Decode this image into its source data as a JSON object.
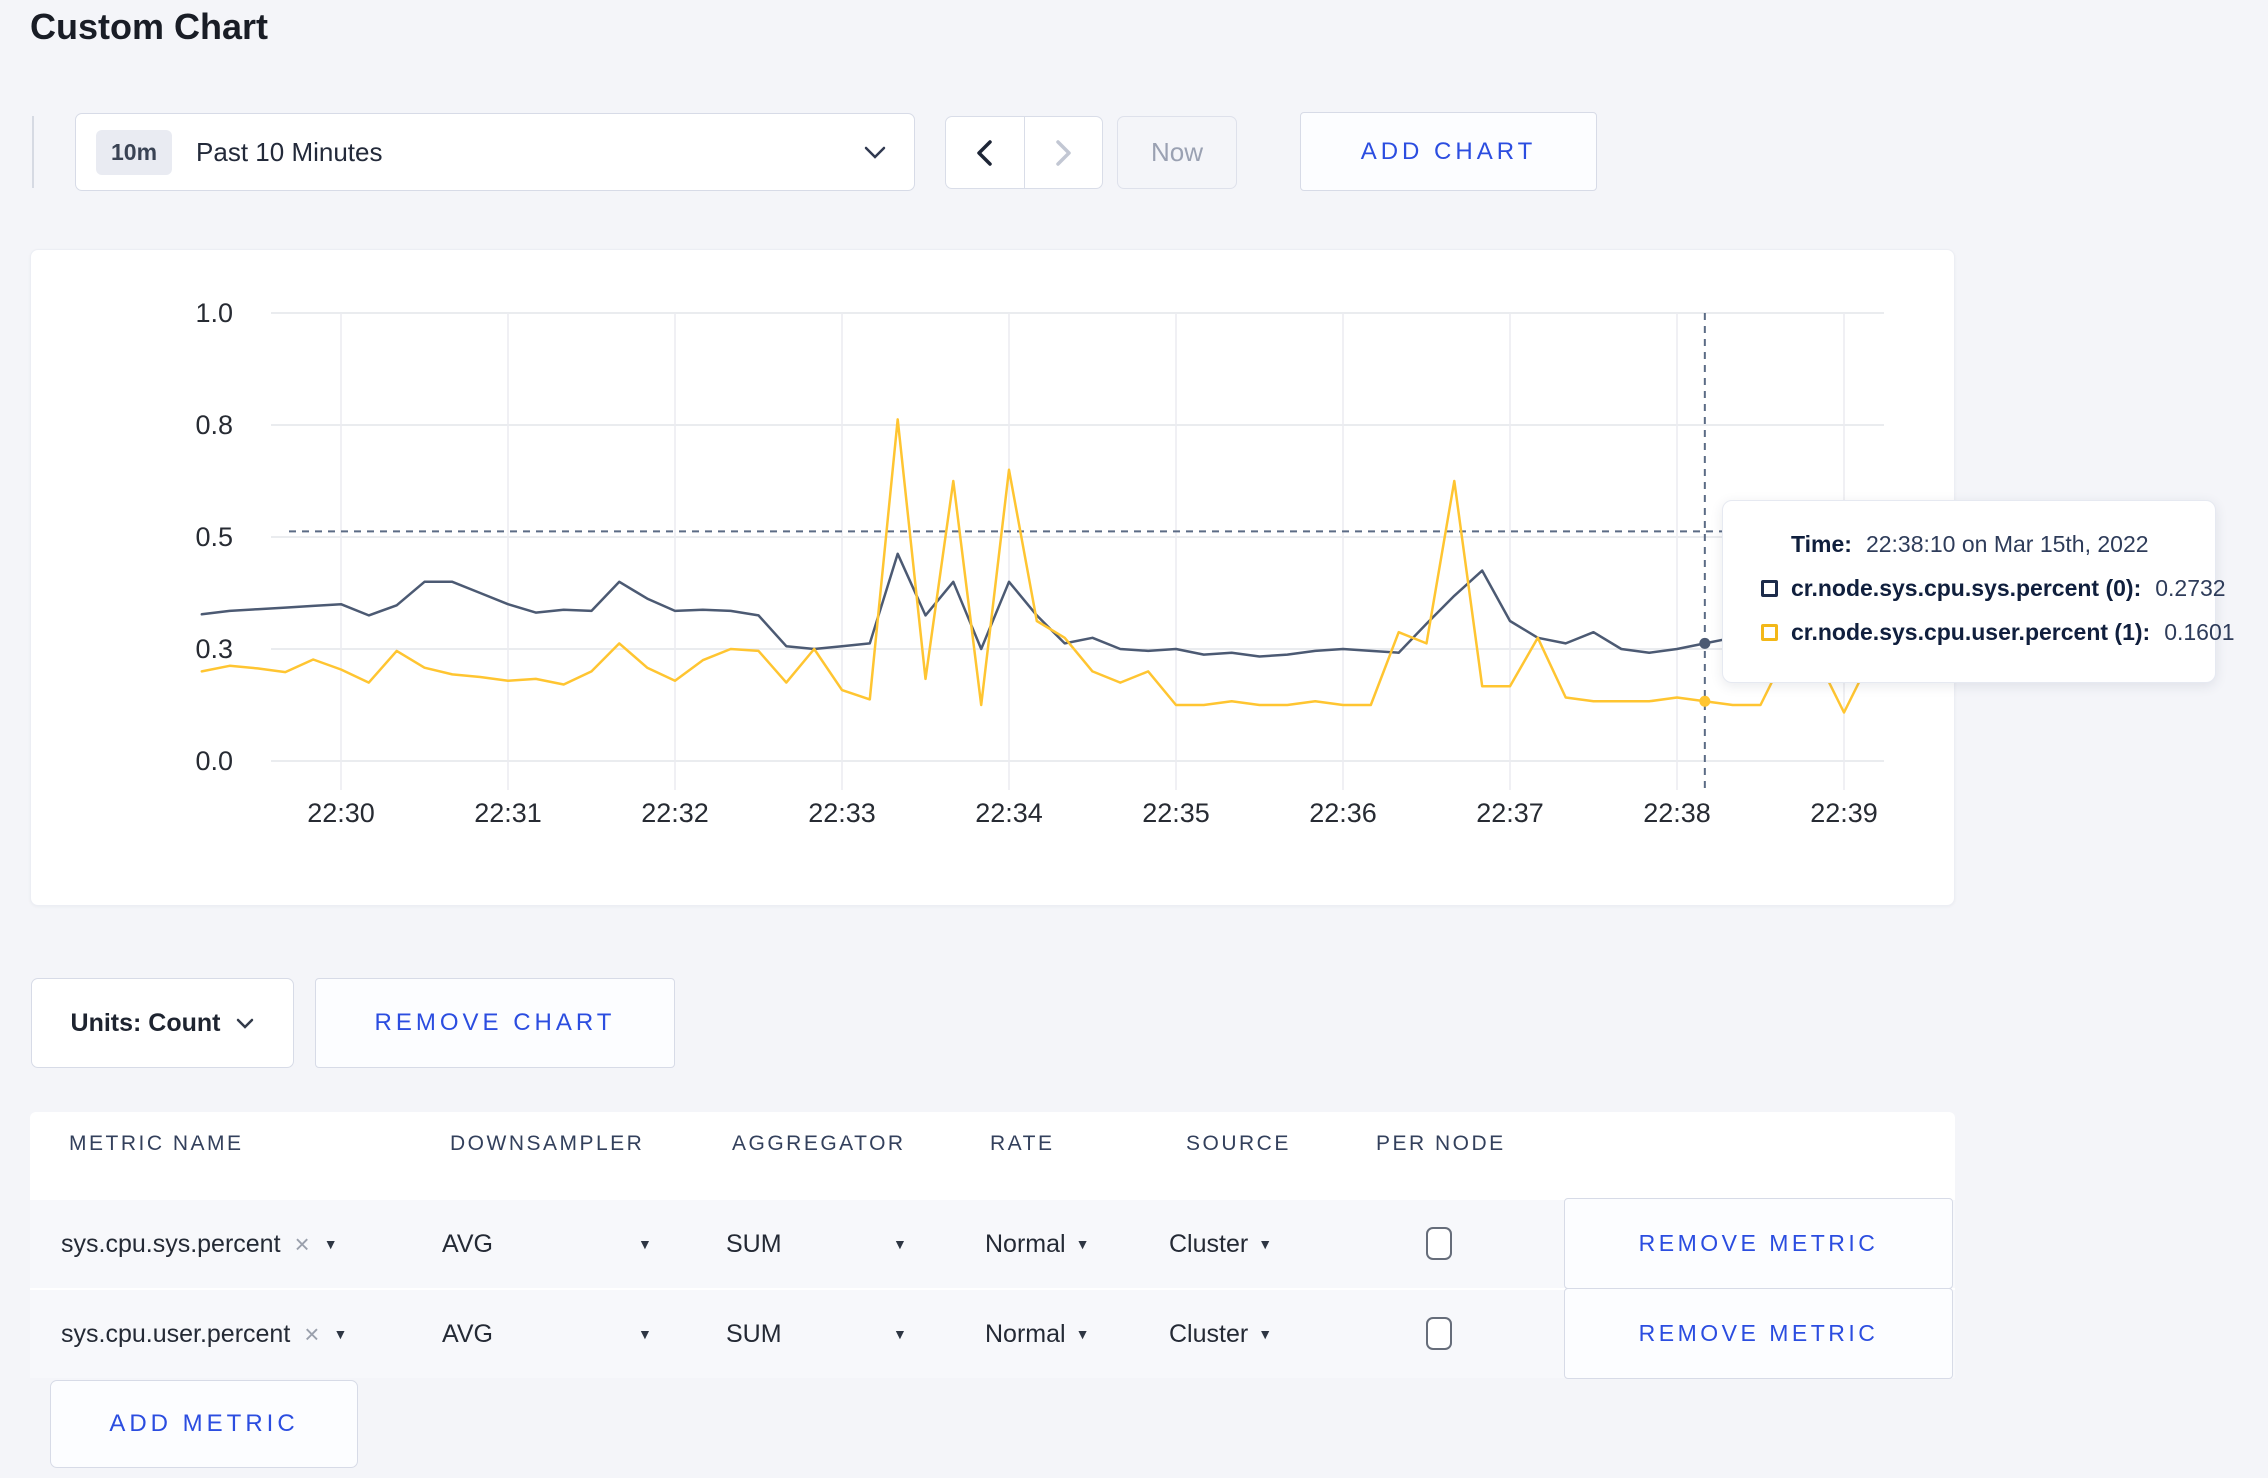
{
  "page": {
    "title": "Custom Chart"
  },
  "toolbar": {
    "time_window": {
      "badge": "10m",
      "label": "Past 10 Minutes"
    },
    "prev_icon": "chevron-left",
    "next_icon": "chevron-right",
    "now_label": "Now",
    "add_chart_label": "ADD CHART"
  },
  "chart_data": {
    "type": "line",
    "title": "",
    "xlabel": "",
    "ylabel": "",
    "grid": true,
    "legend_position": "none",
    "y_tick_labels": [
      "1.0",
      "0.8",
      "0.5",
      "0.3",
      "0.0"
    ],
    "y_tick_values": [
      1.0,
      0.8,
      0.5,
      0.3,
      0.0
    ],
    "x_tick_labels": [
      "22:30",
      "22:31",
      "22:32",
      "22:33",
      "22:34",
      "22:35",
      "22:36",
      "22:37",
      "22:38",
      "22:39"
    ],
    "x_start_offset_sec": -50,
    "interval_sec": 10,
    "series": [
      {
        "name": "cr.node.sys.cpu.sys.percent (0)",
        "color": "#4c5a73",
        "values": [
          0.362,
          0.368,
          0.371,
          0.374,
          0.377,
          0.38,
          0.36,
          0.378,
          0.42,
          0.42,
          0.4,
          0.38,
          0.365,
          0.37,
          0.368,
          0.42,
          0.39,
          0.368,
          0.37,
          0.368,
          0.36,
          0.305,
          0.3,
          0.305,
          0.31,
          0.47,
          0.36,
          0.42,
          0.3,
          0.42,
          0.36,
          0.31,
          0.32,
          0.3,
          0.295,
          0.3,
          0.285,
          0.29,
          0.28,
          0.285,
          0.295,
          0.3,
          0.295,
          0.29,
          0.345,
          0.395,
          0.44,
          0.35,
          0.32,
          0.31,
          0.33,
          0.3,
          0.29,
          0.3,
          0.31,
          0.32,
          0.31,
          0.3,
          0.305,
          0.3,
          0.302
        ]
      },
      {
        "name": "cr.node.sys.cpu.user.percent (1)",
        "color": "#ffc531",
        "values": [
          0.24,
          0.255,
          0.248,
          0.238,
          0.272,
          0.245,
          0.21,
          0.295,
          0.25,
          0.232,
          0.225,
          0.215,
          0.22,
          0.205,
          0.24,
          0.31,
          0.25,
          0.215,
          0.27,
          0.3,
          0.295,
          0.21,
          0.3,
          0.19,
          0.165,
          0.81,
          0.22,
          0.65,
          0.15,
          0.68,
          0.35,
          0.32,
          0.24,
          0.21,
          0.24,
          0.15,
          0.15,
          0.16,
          0.15,
          0.15,
          0.16,
          0.15,
          0.15,
          0.33,
          0.31,
          0.65,
          0.2,
          0.2,
          0.32,
          0.17,
          0.16,
          0.16,
          0.16,
          0.17,
          0.16,
          0.15,
          0.15,
          0.3,
          0.28,
          0.13,
          0.28
        ]
      }
    ],
    "crosshair": {
      "index": 54,
      "hline_value": 0.515
    }
  },
  "tooltip": {
    "time_label": "Time:",
    "time_value": "22:38:10 on Mar 15th, 2022",
    "rows": [
      {
        "label": "cr.node.sys.cpu.sys.percent (0):",
        "value": "0.2732",
        "color": "#1c2b4a"
      },
      {
        "label": "cr.node.sys.cpu.user.percent (1):",
        "value": "0.1601",
        "color": "#f3b818"
      }
    ]
  },
  "chart_controls": {
    "units_label": "Units: Count",
    "remove_chart_label": "REMOVE CHART"
  },
  "metrics_table": {
    "headers": [
      "METRIC NAME",
      "DOWNSAMPLER",
      "AGGREGATOR",
      "RATE",
      "SOURCE",
      "PER NODE"
    ],
    "rows": [
      {
        "metric": "sys.cpu.sys.percent",
        "downsampler": "AVG",
        "aggregator": "SUM",
        "rate": "Normal",
        "source": "Cluster",
        "per_node_checked": false,
        "remove_label": "REMOVE METRIC"
      },
      {
        "metric": "sys.cpu.user.percent",
        "downsampler": "AVG",
        "aggregator": "SUM",
        "rate": "Normal",
        "source": "Cluster",
        "per_node_checked": false,
        "remove_label": "REMOVE METRIC"
      }
    ],
    "add_metric_label": "ADD METRIC"
  },
  "colors": {
    "accent_blue": "#2b4de0",
    "page_background": "#f4f5f9",
    "series_sys": "#4c5a73",
    "series_user": "#ffc531"
  }
}
